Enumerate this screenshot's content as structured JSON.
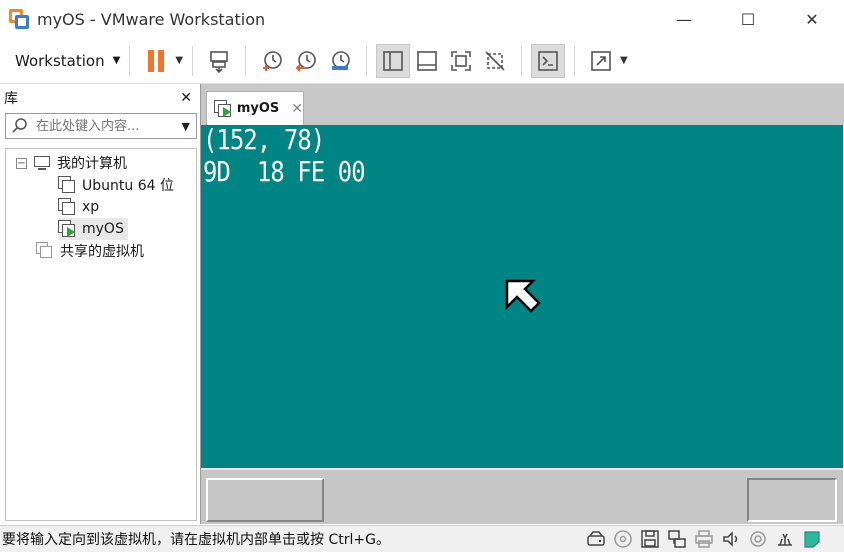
{
  "window": {
    "title": "myOS - VMware Workstation",
    "minimize": "—",
    "maximize": "☐",
    "close": "✕"
  },
  "toolbar": {
    "menu_label": "Workstation",
    "caret": "▼"
  },
  "library": {
    "title": "库",
    "close": "✕",
    "search_placeholder": "在此处键入内容...",
    "tree": {
      "root": "我的计算机",
      "items": [
        "Ubuntu 64 位",
        "xp",
        "myOS"
      ],
      "shared": "共享的虚拟机",
      "collapse_symbol": "−"
    }
  },
  "tabs": [
    {
      "label": "myOS",
      "close": "✕"
    }
  ],
  "vm_screen": {
    "background": "#008484",
    "lines": [
      "(152, 78)",
      "9D  18 FE 00"
    ]
  },
  "statusbar": {
    "message": "要将输入定向到该虚拟机，请在虚拟机内部单击或按 Ctrl+G。"
  },
  "colors": {
    "accent_orange": "#f0762a",
    "accent_blue": "#3c7fc7",
    "play_green": "#2fa33a"
  }
}
